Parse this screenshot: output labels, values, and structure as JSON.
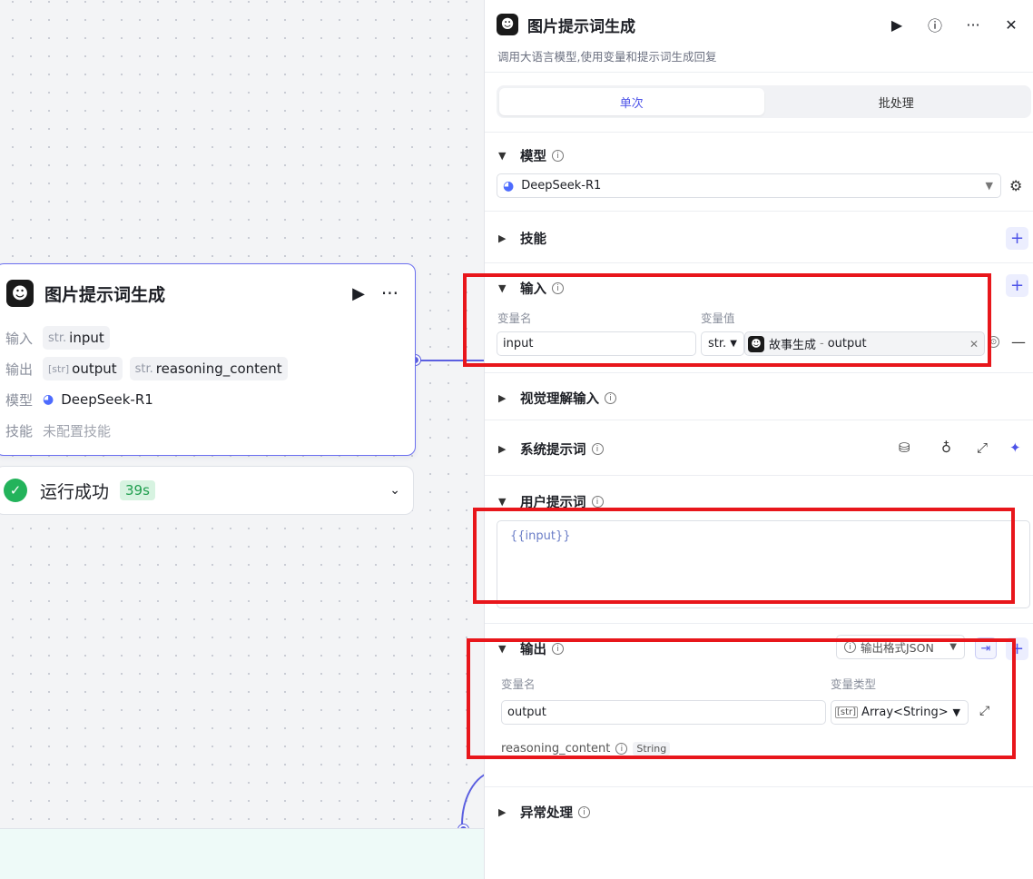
{
  "node": {
    "title": "图片提示词生成",
    "rows": [
      {
        "label": "输入",
        "tags": [
          {
            "type": "str.",
            "name": "input"
          }
        ]
      },
      {
        "label": "输出",
        "tags": [
          {
            "type": "[str]",
            "name": "output"
          },
          {
            "type": "str.",
            "name": "reasoning_content"
          }
        ]
      },
      {
        "label": "模型",
        "value": "DeepSeek-R1"
      },
      {
        "label": "技能",
        "value": "未配置技能"
      }
    ],
    "status": "运行成功",
    "time": "39s"
  },
  "panel": {
    "title": "图片提示词生成",
    "description": "调用大语言模型,使用变量和提示词生成回复",
    "tabs": [
      "单次",
      "批处理"
    ],
    "model": {
      "label": "模型",
      "selected": "DeepSeek-R1"
    },
    "skills": {
      "label": "技能"
    },
    "input": {
      "label": "输入",
      "col_name": "变量名",
      "col_value": "变量值",
      "var_name": "input",
      "var_type": "str.",
      "ref_node": "故事生成",
      "ref_sep": "-",
      "ref_var": "output"
    },
    "vision": {
      "label": "视觉理解输入"
    },
    "system_prompt": {
      "label": "系统提示词"
    },
    "user_prompt": {
      "label": "用户提示词",
      "content": "{{input}}"
    },
    "output": {
      "label": "输出",
      "format": "输出格式JSON",
      "col_name": "变量名",
      "col_type": "变量类型",
      "var_name": "output",
      "var_type_badge": "[str]",
      "var_type": "Array<String>",
      "reason_name": "reasoning_content",
      "reason_type": "String"
    },
    "error": {
      "label": "异常处理"
    }
  },
  "colors": {
    "accent": "#4d53e8",
    "success": "#23b35b",
    "highlight": "#e8161b"
  }
}
